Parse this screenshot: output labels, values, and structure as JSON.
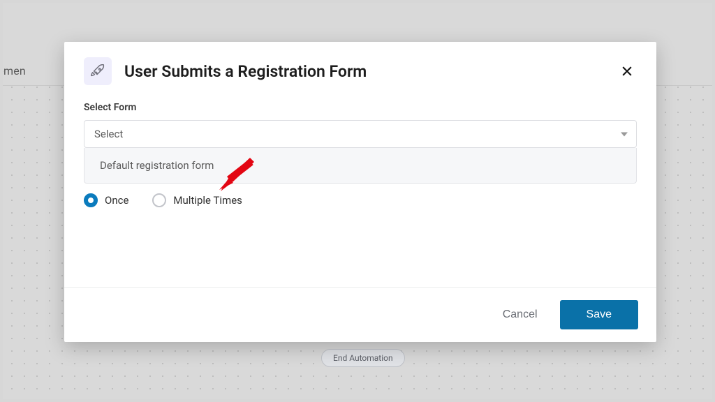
{
  "background": {
    "truncated_label": "ngagemen",
    "pill_label": "End Automation"
  },
  "modal": {
    "icon": "rocket-icon",
    "title": "User Submits a Registration Form",
    "field_label": "Select Form",
    "select_value": "Select",
    "dropdown": {
      "options": [
        {
          "label": "Default registration form"
        }
      ]
    },
    "radios": {
      "items": [
        {
          "label": "Once",
          "selected": true
        },
        {
          "label": "Multiple Times",
          "selected": false
        }
      ]
    },
    "footer": {
      "cancel_label": "Cancel",
      "save_label": "Save"
    }
  },
  "colors": {
    "accent": "#0a71a8",
    "radio_selected": "#0a7bbd",
    "icon_bg": "#efeefc"
  }
}
